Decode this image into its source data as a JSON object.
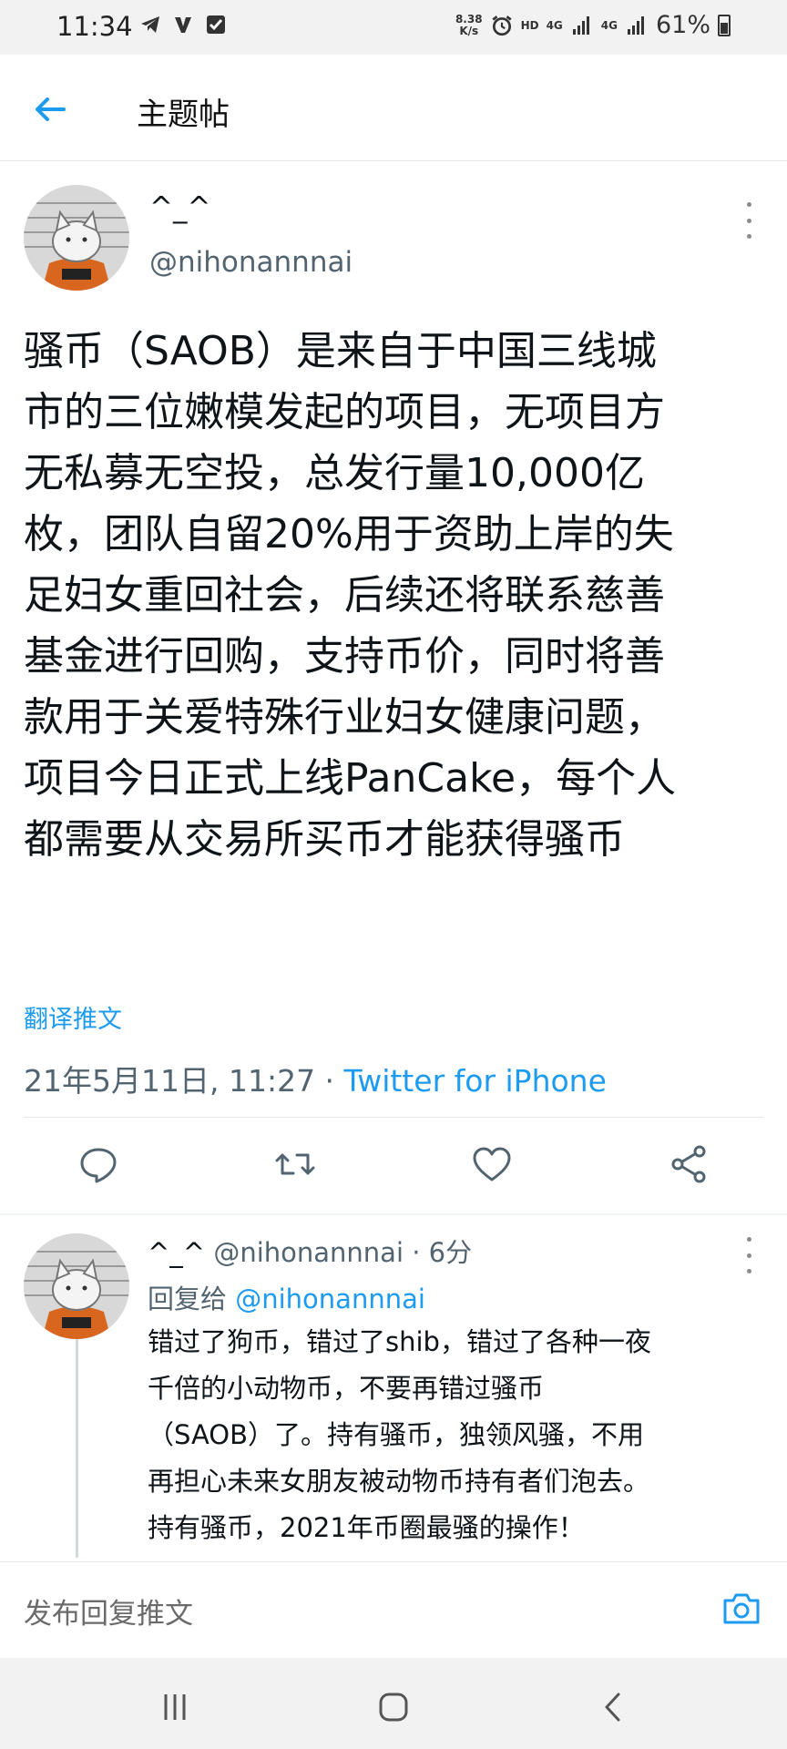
{
  "status_bar": {
    "time": "11:34",
    "left_icons": [
      "telegram-icon",
      "v-app-icon",
      "checkbox-app-icon"
    ],
    "net_speed_value": "8.38",
    "net_speed_unit": "K/s",
    "hd_label": "HD",
    "network_1": "4G",
    "network_2": "4G",
    "battery": "61%"
  },
  "header": {
    "back_icon": "arrow-left-icon",
    "title": "主题帖"
  },
  "tweet": {
    "display_name": "^_^",
    "handle": "@nihonannnai",
    "body_lines": [
      "骚币（SAOB）是来自于中国三线城",
      "市的三位嫩模发起的项目，无项目方",
      "无私募无空投，总发行量10,000亿",
      "枚，团队自留20%用于资助上岸的失",
      "足妇女重回社会，后续还将联系慈善",
      "基金进行回购，支持币价，同时将善",
      "款用于关爱特殊行业妇女健康问题，",
      "项目今日正式上线PanCake，每个人",
      "都需要从交易所买币才能获得骚币"
    ],
    "translate_label": "翻译推文",
    "timestamp": "21年5月11日, 11:27",
    "separator": " · ",
    "source": "Twitter for iPhone",
    "actions": [
      "reply-icon",
      "retweet-icon",
      "like-icon",
      "share-icon"
    ]
  },
  "reply": {
    "display_name": "^_^",
    "handle": "@nihonannnai",
    "time": "· 6分",
    "reply_to_label": "回复给",
    "reply_to_handle": "@nihonannnai",
    "body_lines": [
      "错过了狗币，错过了shib，错过了各种一夜",
      "千倍的小动物币，不要再错过骚币",
      "（SAOB）了。持有骚币，独领风骚，不用",
      "再担心未来女朋友被动物币持有者们泡去。",
      "持有骚币，2021年币圈最骚的操作！"
    ]
  },
  "compose": {
    "placeholder": "发布回复推文",
    "camera_icon": "camera-icon"
  },
  "nav_bar": {
    "buttons": [
      "recent-apps-icon",
      "home-icon",
      "back-icon"
    ]
  },
  "colors": {
    "accent": "#1d9bf0",
    "secondary_text": "#536471",
    "primary_text": "#0f1419"
  }
}
